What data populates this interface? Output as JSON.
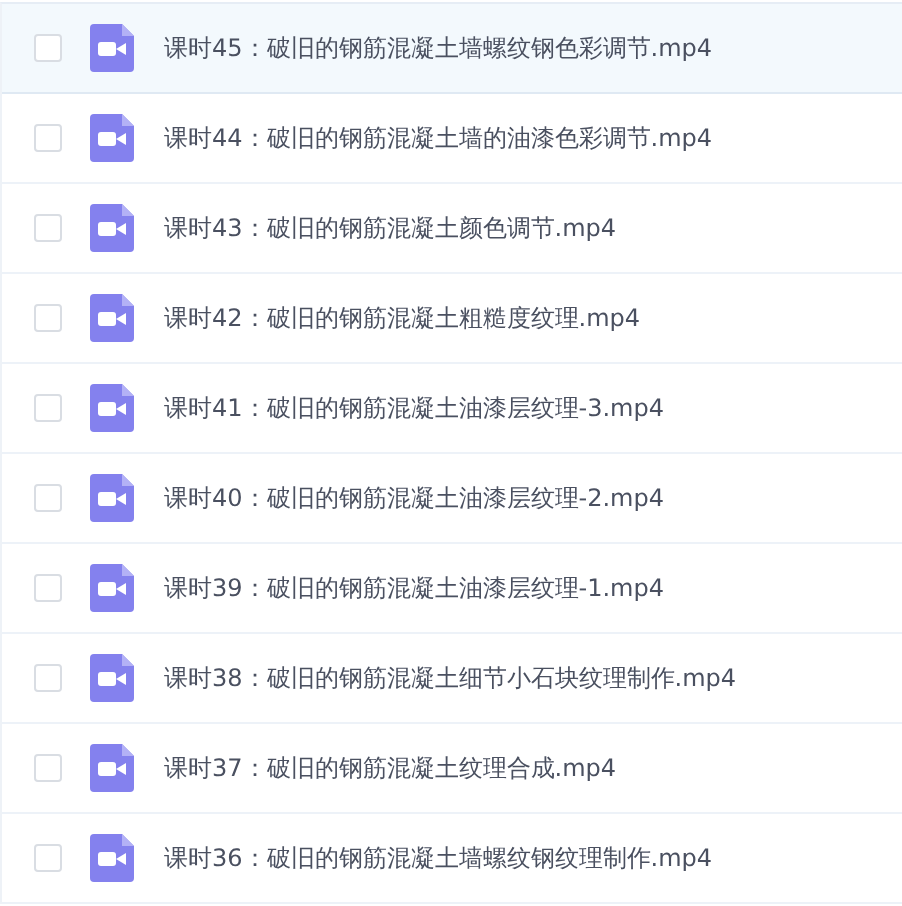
{
  "files": [
    {
      "name": "课时45：破旧的钢筋混凝土墙螺纹钢色彩调节.mp4",
      "selected": true,
      "checked": false
    },
    {
      "name": "课时44：破旧的钢筋混凝土墙的油漆色彩调节.mp4",
      "selected": false,
      "checked": false
    },
    {
      "name": "课时43：破旧的钢筋混凝土颜色调节.mp4",
      "selected": false,
      "checked": false
    },
    {
      "name": "课时42：破旧的钢筋混凝土粗糙度纹理.mp4",
      "selected": false,
      "checked": false
    },
    {
      "name": "课时41：破旧的钢筋混凝土油漆层纹理-3.mp4",
      "selected": false,
      "checked": false
    },
    {
      "name": "课时40：破旧的钢筋混凝土油漆层纹理-2.mp4",
      "selected": false,
      "checked": false
    },
    {
      "name": "课时39：破旧的钢筋混凝土油漆层纹理-1.mp4",
      "selected": false,
      "checked": false
    },
    {
      "name": "课时38：破旧的钢筋混凝土细节小石块纹理制作.mp4",
      "selected": false,
      "checked": false
    },
    {
      "name": "课时37：破旧的钢筋混凝土纹理合成.mp4",
      "selected": false,
      "checked": false
    },
    {
      "name": "课时36：破旧的钢筋混凝土墙螺纹钢纹理制作.mp4",
      "selected": false,
      "checked": false
    }
  ]
}
